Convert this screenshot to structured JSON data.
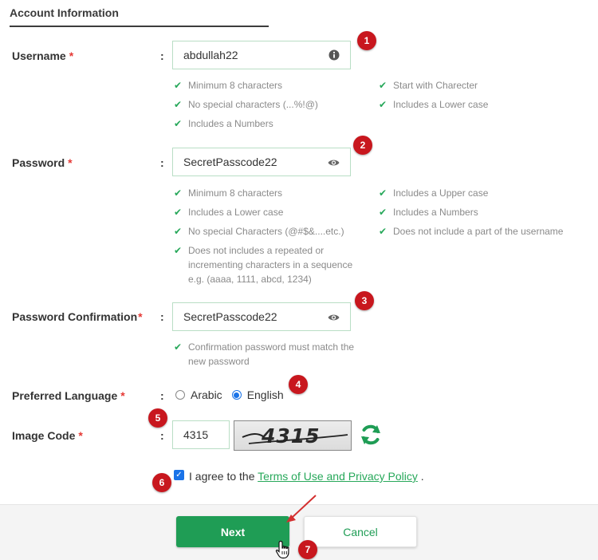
{
  "section": {
    "title": "Account Information"
  },
  "required_mark": "*",
  "colon": ":",
  "username": {
    "label": "Username",
    "value": "abdullah22",
    "rules_left": [
      "Minimum 8 characters",
      "No special characters (...%!@)",
      "Includes a Numbers"
    ],
    "rules_right": [
      "Start with Charecter",
      "Includes a Lower case"
    ]
  },
  "password": {
    "label": "Password",
    "value": "SecretPasscode22",
    "rules_left": [
      "Minimum 8 characters",
      "Includes a Lower case",
      "No special Characters (@#$&....etc.)",
      "Does not includes a repeated or incrementing characters in a sequence e.g. (aaaa, 1111, abcd, 1234)"
    ],
    "rules_right": [
      "Includes a Upper case",
      "Includes a Numbers",
      "Does not include a part of the username"
    ]
  },
  "confirm": {
    "label": "Password Confirmation",
    "value": "SecretPasscode22",
    "rule": "Confirmation password must match the new password"
  },
  "language": {
    "label": "Preferred Language",
    "options": [
      "Arabic",
      "English"
    ],
    "selected": "English"
  },
  "image_code": {
    "label": "Image Code",
    "value": "4315",
    "captcha_text": "4315"
  },
  "agree": {
    "text": "I agree to the",
    "link": "Terms of Use and Privacy Policy",
    "suffix": "."
  },
  "buttons": {
    "next": "Next",
    "cancel": "Cancel"
  },
  "badges": [
    "1",
    "2",
    "3",
    "4",
    "5",
    "6",
    "7"
  ],
  "colors": {
    "accent": "#1f9d55",
    "required": "#e53935",
    "badge": "#c8171e",
    "radio": "#1a73e8"
  }
}
